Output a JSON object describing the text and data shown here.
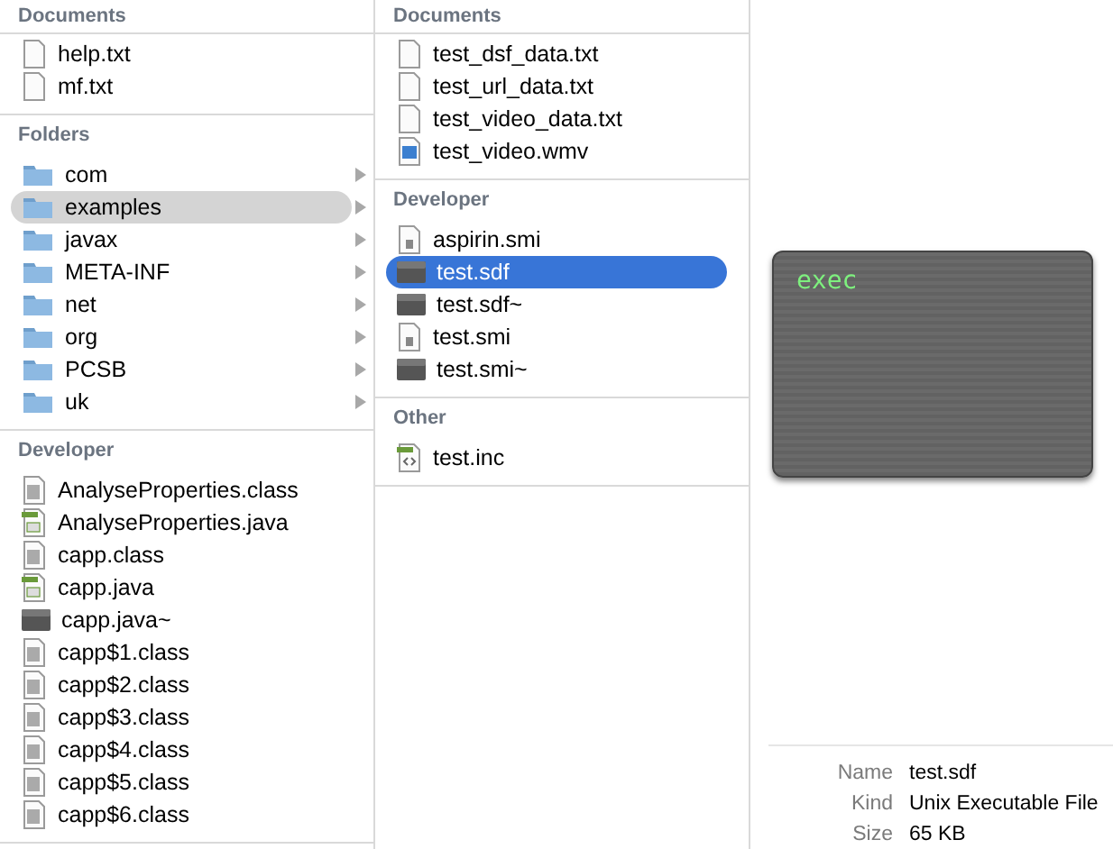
{
  "columns": [
    {
      "active": false,
      "groups": [
        {
          "title": "Documents",
          "items": [
            {
              "name": "help.txt",
              "kind": "text",
              "selected": false
            },
            {
              "name": "mf.txt",
              "kind": "text",
              "selected": false
            }
          ]
        },
        {
          "title": "Folders",
          "items": [
            {
              "name": "com",
              "kind": "folder",
              "selected": false
            },
            {
              "name": "examples",
              "kind": "folder",
              "selected": true
            },
            {
              "name": "javax",
              "kind": "folder",
              "selected": false
            },
            {
              "name": "META-INF",
              "kind": "folder",
              "selected": false
            },
            {
              "name": "net",
              "kind": "folder",
              "selected": false
            },
            {
              "name": "org",
              "kind": "folder",
              "selected": false
            },
            {
              "name": "PCSB",
              "kind": "folder",
              "selected": false
            },
            {
              "name": "uk",
              "kind": "folder",
              "selected": false
            }
          ]
        },
        {
          "title": "Developer",
          "items": [
            {
              "name": "AnalyseProperties.class",
              "kind": "class",
              "selected": false
            },
            {
              "name": "AnalyseProperties.java",
              "kind": "java",
              "selected": false
            },
            {
              "name": "capp.class",
              "kind": "class",
              "selected": false
            },
            {
              "name": "capp.java",
              "kind": "java",
              "selected": false
            },
            {
              "name": "capp.java~",
              "kind": "exec",
              "selected": false
            },
            {
              "name": "capp$1.class",
              "kind": "class",
              "selected": false
            },
            {
              "name": "capp$2.class",
              "kind": "class",
              "selected": false
            },
            {
              "name": "capp$3.class",
              "kind": "class",
              "selected": false
            },
            {
              "name": "capp$4.class",
              "kind": "class",
              "selected": false
            },
            {
              "name": "capp$5.class",
              "kind": "class",
              "selected": false
            },
            {
              "name": "capp$6.class",
              "kind": "class",
              "selected": false
            }
          ]
        }
      ]
    },
    {
      "active": true,
      "groups": [
        {
          "title": "Documents",
          "items": [
            {
              "name": "test_dsf_data.txt",
              "kind": "text",
              "selected": false
            },
            {
              "name": "test_url_data.txt",
              "kind": "text",
              "selected": false
            },
            {
              "name": "test_video_data.txt",
              "kind": "text",
              "selected": false
            },
            {
              "name": "test_video.wmv",
              "kind": "video",
              "selected": false
            }
          ]
        },
        {
          "title": "Developer",
          "items": [
            {
              "name": "aspirin.smi",
              "kind": "smi",
              "selected": false
            },
            {
              "name": "test.sdf",
              "kind": "exec",
              "selected": true
            },
            {
              "name": "test.sdf~",
              "kind": "exec",
              "selected": false
            },
            {
              "name": "test.smi",
              "kind": "smi",
              "selected": false
            },
            {
              "name": "test.smi~",
              "kind": "exec",
              "selected": false
            }
          ]
        },
        {
          "title": "Other",
          "items": [
            {
              "name": "test.inc",
              "kind": "inc",
              "selected": false
            }
          ]
        }
      ]
    }
  ],
  "preview": {
    "icon_label": "exec",
    "info": [
      {
        "label": "Name",
        "value": "test.sdf"
      },
      {
        "label": "Kind",
        "value": "Unix Executable File"
      },
      {
        "label": "Size",
        "value": "65 KB"
      }
    ]
  }
}
